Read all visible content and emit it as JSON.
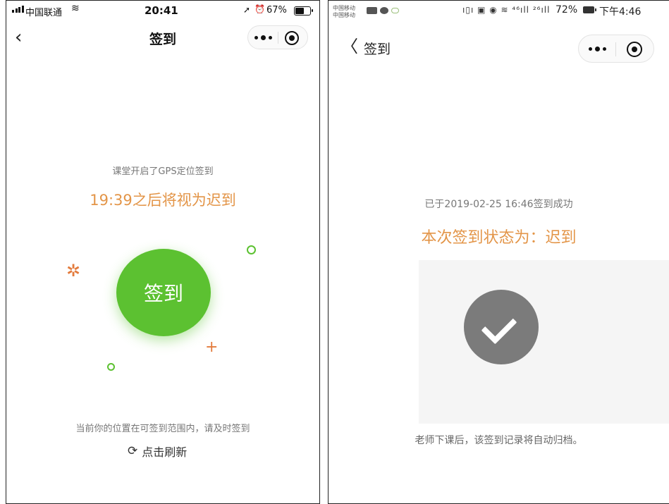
{
  "left": {
    "status_bar": {
      "carrier": "中国联通",
      "wifi_icon": "wifi-icon",
      "time": "20:41",
      "location_icon": "location-arrow-icon",
      "alarm_icon": "alarm-icon",
      "battery_pct": "67%",
      "battery_level": 0.67
    },
    "nav": {
      "back_glyph": "‹",
      "title": "签到"
    },
    "capsule": {
      "more_icon": "more-dots-icon",
      "close_icon": "target-close-icon"
    },
    "hint": "课堂开启了GPS定位签到",
    "deadline": "19:39之后将视为迟到",
    "checkin_button": "签到",
    "decorations": {
      "star_glyph": "✲",
      "plus_glyph": "+"
    },
    "location_text": "当前你的位置在可签到范围内，请及时签到",
    "refresh": {
      "icon": "refresh-icon",
      "label": "点击刷新"
    },
    "colors": {
      "accent_green": "#5cc131",
      "accent_orange": "#e39548"
    }
  },
  "right": {
    "status_bar": {
      "carrier_line_1": "中国移动",
      "carrier_line_2": "中国移动",
      "icons_text": "ı▯ı ▣ ◉ ≋ ⁴⁶ıll ²⁶ıll",
      "battery_pct": "72%",
      "time": "下午4:46"
    },
    "nav": {
      "back_glyph": "〈",
      "title": "签到"
    },
    "capsule": {
      "more_icon": "more-dots-icon",
      "close_icon": "target-close-icon"
    },
    "success_text": "已于2019-02-25 16:46签到成功",
    "status_text": "本次签到状态为：迟到",
    "check_icon": "checkmark-icon",
    "archive_text": "老师下课后，该签到记录将自动归档。",
    "colors": {
      "check_gray": "#7b7b7b",
      "accent_orange": "#e39548"
    }
  }
}
